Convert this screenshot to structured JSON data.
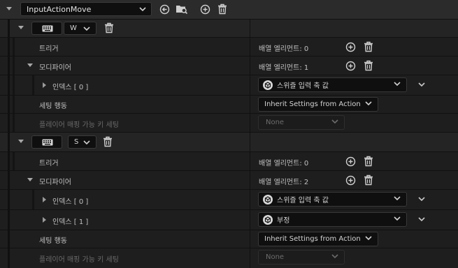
{
  "header": {
    "action_name": "InputActionMove"
  },
  "mappings": [
    {
      "key": "W",
      "trigger_label": "트리거",
      "trigger_value": "배열 엘리먼트: 0",
      "modifier_label": "모디파이어",
      "modifier_value": "배열 엘리먼트: 1",
      "indices": [
        {
          "label": "인덱스 [ 0 ]",
          "value": "스위즐 입력 축 값"
        }
      ],
      "setting_label": "세팅 행동",
      "setting_value": "Inherit Settings from Action",
      "player_label": "플레이어 매핑 가능 키 세팅",
      "player_value": "None"
    },
    {
      "key": "S",
      "trigger_label": "트리거",
      "trigger_value": "배열 엘리먼트: 0",
      "modifier_label": "모디파이어",
      "modifier_value": "배열 엘리먼트: 2",
      "indices": [
        {
          "label": "인덱스 [ 0 ]",
          "value": "스위즐 입력 축 값"
        },
        {
          "label": "인덱스 [ 1 ]",
          "value": "부정"
        }
      ],
      "setting_label": "세팅 행동",
      "setting_value": "Inherit Settings from Action",
      "player_label": "플레이어 매핑 가능 키 세팅",
      "player_value": "None"
    }
  ],
  "icons": {
    "expand": "chevron-down-icon",
    "collapse": "chevron-right-icon",
    "keyboard": "keyboard-icon",
    "add": "plus-circle-icon",
    "delete": "trash-icon",
    "back": "arrow-left-circle-icon",
    "browse": "folder-search-icon",
    "modifier": "modifier-icon"
  },
  "colors": {
    "background": "#1a1a1a",
    "field": "#0f0f0f",
    "text": "#c0c0c0",
    "muted": "#6a6a6a"
  }
}
